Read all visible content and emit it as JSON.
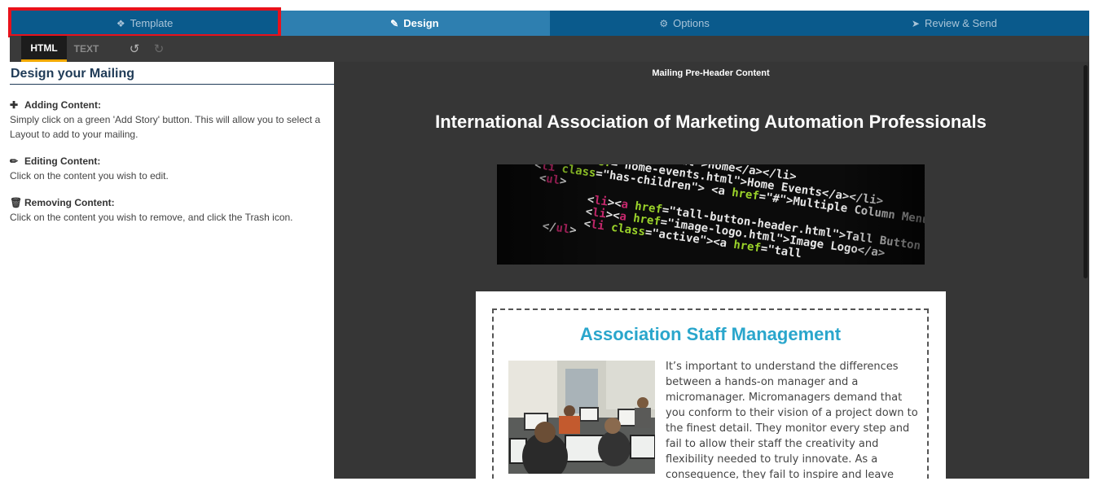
{
  "steps": [
    {
      "label": "Template",
      "icon": "puzzle-icon"
    },
    {
      "label": "Design",
      "icon": "paint-brush-icon"
    },
    {
      "label": "Options",
      "icon": "cogs-icon"
    },
    {
      "label": "Review & Send",
      "icon": "paper-plane-icon"
    }
  ],
  "toolbar": {
    "html_tab": "HTML",
    "text_tab": "TEXT",
    "undo_icon": "undo-icon",
    "redo_icon": "redo-icon"
  },
  "left_panel": {
    "title": "Design your Mailing",
    "items": [
      {
        "icon": "plus-icon",
        "heading": "Adding Content:",
        "text": "Simply click on a green 'Add Story' button. This will allow you to select a Layout to add to your mailing."
      },
      {
        "icon": "pencil-icon",
        "heading": "Editing Content:",
        "text": "Click on the content you wish to edit."
      },
      {
        "icon": "trash-icon",
        "heading": "Removing Content:",
        "text": "Click on the content you wish to remove, and click the Trash icon."
      }
    ]
  },
  "preview": {
    "preheader": "Mailing Pre-Header Content",
    "org_title": "International Association of Marketing Automation Professionals",
    "story_title": "Association Staff Management",
    "story_text": "It’s important to understand the differences between a hands-on manager and a micromanager. Micromanagers demand that you conform to their vision of a project down to the finest detail. They monitor every step and fail to allow their staff the creativity and flexibility needed to truly innovate. As a consequence, they fail to inspire and leave"
  },
  "colors": {
    "step_bg": "#0a5a8c",
    "step_active_bg": "#2e7fb0",
    "highlight_border": "#e8111b",
    "story_title": "#2aa6cc"
  }
}
